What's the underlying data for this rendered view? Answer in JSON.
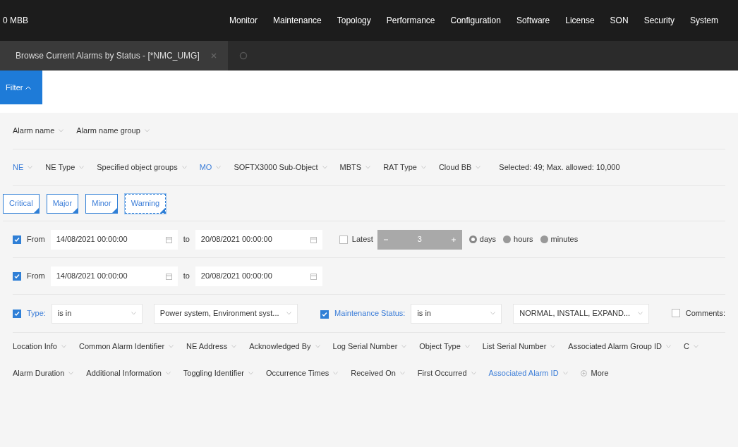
{
  "app": {
    "title": "0 MBB"
  },
  "menu": [
    "Monitor",
    "Maintenance",
    "Topology",
    "Performance",
    "Configuration",
    "Software",
    "License",
    "SON",
    "Security",
    "System"
  ],
  "tabs": [
    {
      "label": "Browse Current Alarms by Status - [*NMC_UMG]",
      "selected": true
    }
  ],
  "filter_button": {
    "label": "Filter"
  },
  "alarm_name_row": [
    {
      "label": "Alarm name",
      "active": false
    },
    {
      "label": "Alarm name group",
      "active": false
    }
  ],
  "object_row": [
    {
      "label": "NE",
      "active": true
    },
    {
      "label": "NE Type",
      "active": false
    },
    {
      "label": "Specified object groups",
      "active": false
    },
    {
      "label": "MO",
      "active": true
    },
    {
      "label": "SOFTX3000 Sub-Object",
      "active": false
    },
    {
      "label": "MBTS",
      "active": false
    },
    {
      "label": "RAT Type",
      "active": false
    },
    {
      "label": "Cloud BB",
      "active": false
    }
  ],
  "object_summary": "Selected: 49; Max. allowed: 10,000",
  "severities": [
    {
      "label": "Critical",
      "focused": false
    },
    {
      "label": "Major",
      "focused": false
    },
    {
      "label": "Minor",
      "focused": false
    },
    {
      "label": "Warning",
      "focused": true
    }
  ],
  "time_rows": [
    {
      "checked": true,
      "from_label": "From",
      "from": "14/08/2021 00:00:00",
      "to_label": "to",
      "to": "20/08/2021 00:00:00",
      "latest": {
        "checked": false,
        "label": "Latest",
        "value": "3",
        "units": [
          {
            "label": "days",
            "selected": true
          },
          {
            "label": "hours",
            "selected": false
          },
          {
            "label": "minutes",
            "selected": false
          }
        ]
      }
    },
    {
      "checked": true,
      "from_label": "From",
      "from": "14/08/2021 00:00:00",
      "to_label": "to",
      "to": "20/08/2021 00:00:00"
    }
  ],
  "type_filter": {
    "checked": true,
    "label": "Type:",
    "operator": "is in",
    "value": "Power system, Environment syst..."
  },
  "maintenance_filter": {
    "checked": true,
    "label": "Maintenance Status:",
    "operator": "is in",
    "value": "NORMAL, INSTALL, EXPAND..."
  },
  "comments_filter": {
    "checked": false,
    "label": "Comments:"
  },
  "field_rows": [
    [
      {
        "label": "Location Info",
        "active": false
      },
      {
        "label": "Common Alarm Identifier",
        "active": false
      },
      {
        "label": "NE Address",
        "active": false
      },
      {
        "label": "Acknowledged By",
        "active": false
      },
      {
        "label": "Log Serial Number",
        "active": false
      },
      {
        "label": "Object Type",
        "active": false
      },
      {
        "label": "List Serial Number",
        "active": false
      },
      {
        "label": "Associated Alarm Group ID",
        "active": false
      },
      {
        "label": "C",
        "active": false
      }
    ],
    [
      {
        "label": "Alarm Duration",
        "active": false
      },
      {
        "label": "Additional Information",
        "active": false
      },
      {
        "label": "Toggling Identifier",
        "active": false
      },
      {
        "label": "Occurrence Times",
        "active": false
      },
      {
        "label": "Received On",
        "active": false
      },
      {
        "label": "First Occurred",
        "active": false
      },
      {
        "label": "Associated Alarm ID",
        "active": true
      }
    ]
  ],
  "more_button": {
    "label": "More"
  }
}
